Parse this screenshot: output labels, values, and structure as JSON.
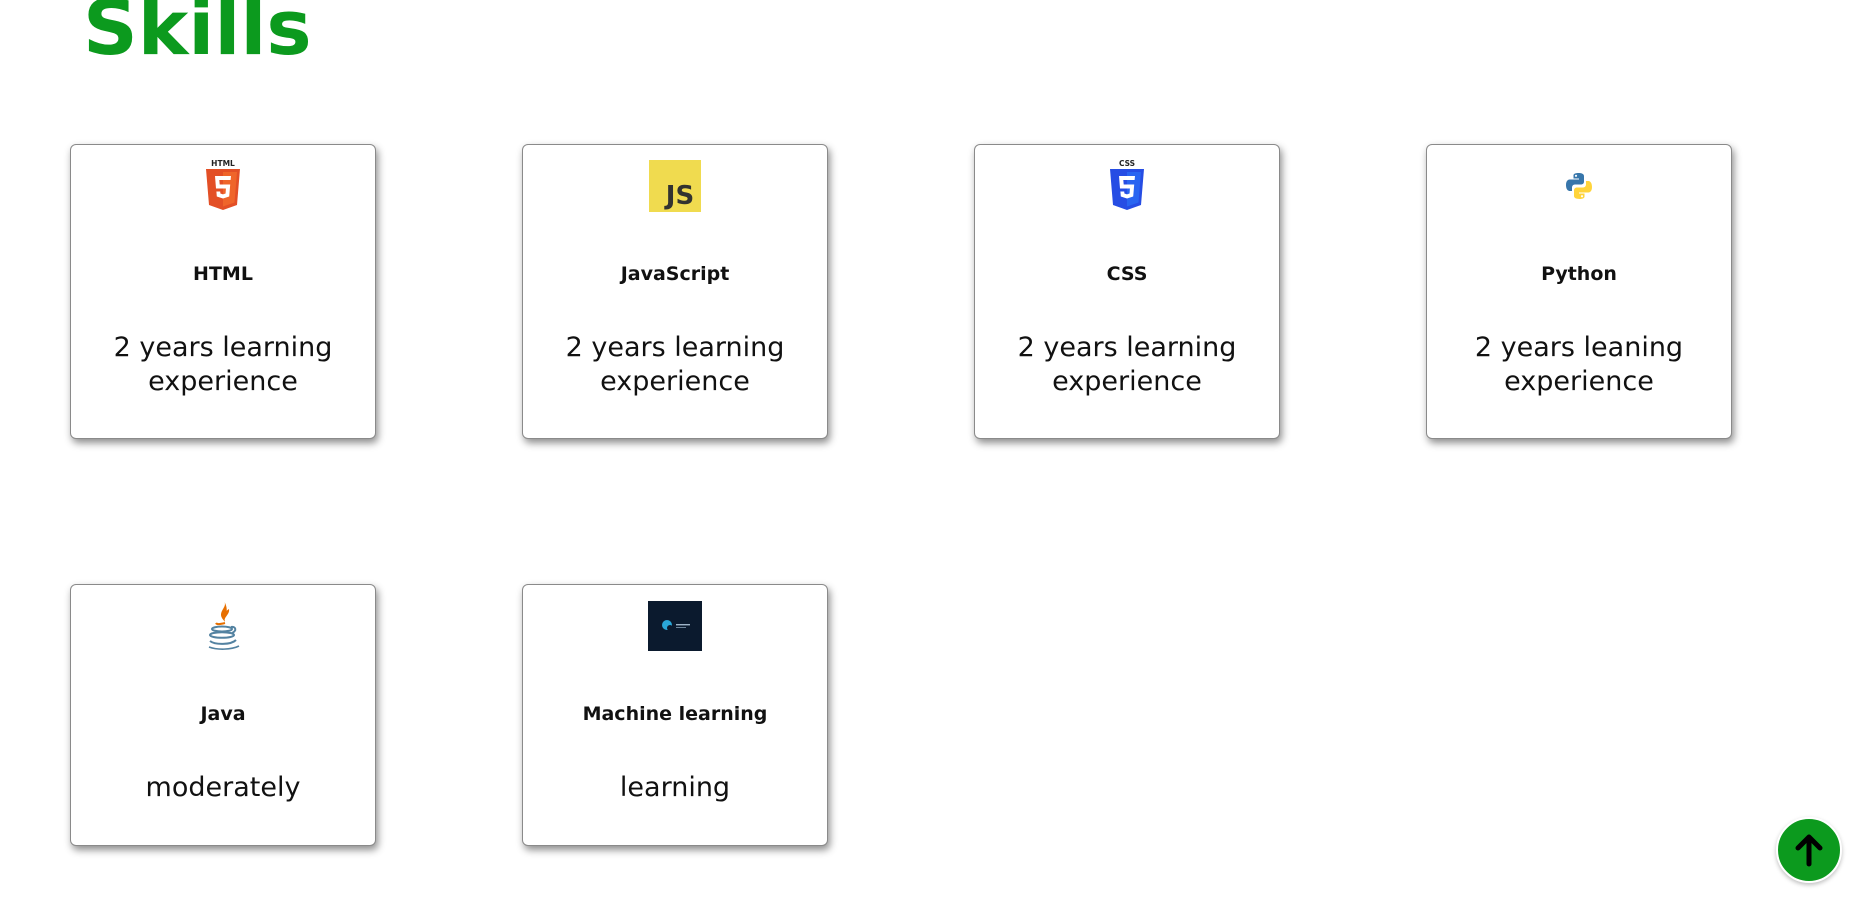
{
  "section": {
    "title": "Skills",
    "accent_color": "#0c9a1e"
  },
  "skills": [
    {
      "icon": "html5-icon",
      "name": "HTML",
      "description": "2 years learning experience"
    },
    {
      "icon": "javascript-icon",
      "name": "JavaScript",
      "description": "2 years learning experience"
    },
    {
      "icon": "css3-icon",
      "name": "CSS",
      "description": "2 years learning experience"
    },
    {
      "icon": "python-icon",
      "name": "Python",
      "description": "2 years leaning experience"
    },
    {
      "icon": "java-icon",
      "name": "Java",
      "description": "moderately"
    },
    {
      "icon": "machine-learning-icon",
      "name": "Machine learning",
      "description": "learning"
    }
  ],
  "scroll_top": {
    "icon": "arrow-up-icon"
  }
}
